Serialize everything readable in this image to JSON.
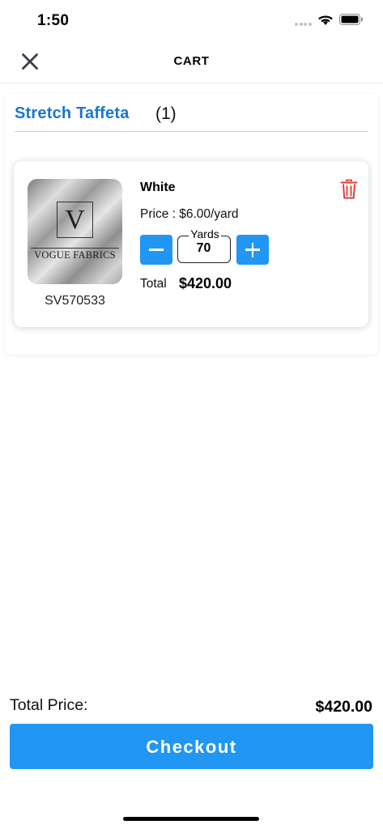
{
  "status_bar": {
    "time": "1:50",
    "icons": [
      "cellular-signal-icon",
      "wifi-icon",
      "battery-icon"
    ]
  },
  "header": {
    "title": "CART",
    "close_icon": "close-icon"
  },
  "group": {
    "title": "Stretch Taffeta",
    "count": "(1)"
  },
  "item": {
    "image_brand_letter": "V",
    "image_brand_text": "VOGUE FABRICS",
    "sku": "SV570533",
    "color": "White",
    "price": "Price : $6.00/yard",
    "quantity_label": "Yards",
    "quantity_value": "70",
    "total_label": "Total",
    "total_value": "$420.00",
    "delete_icon": "trash-icon"
  },
  "footer": {
    "total_price_label": "Total Price:",
    "total_price_value": "$420.00",
    "checkout_label": "Checkout"
  },
  "colors": {
    "accent": "#2196f3",
    "title_blue": "#1976d2",
    "delete_red": "#e53935",
    "icon_dark": "#3c3c4a"
  }
}
